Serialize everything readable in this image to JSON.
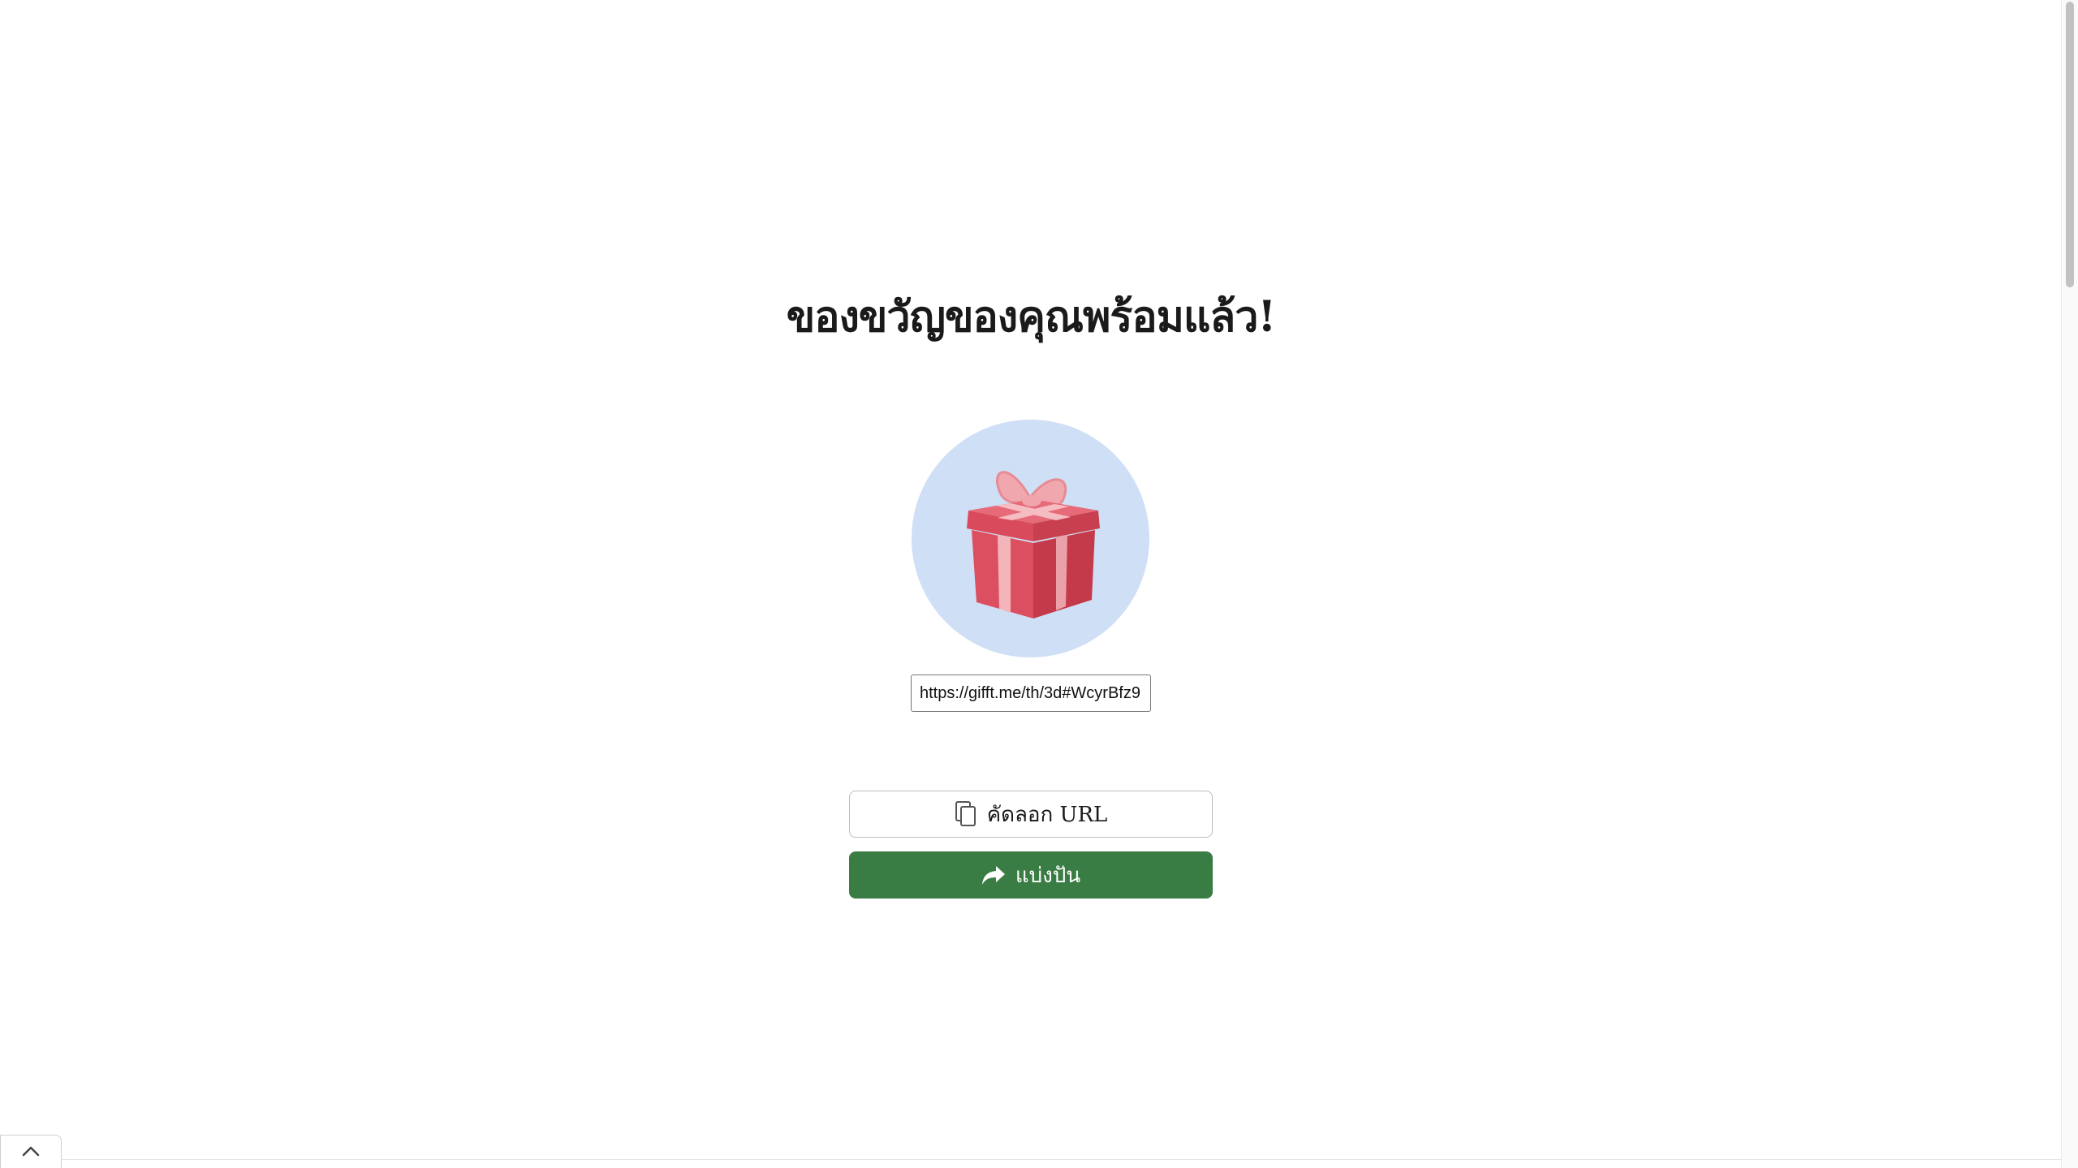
{
  "heading": {
    "title": "ของขวัญของคุณพร้อมแล้ว!"
  },
  "gift": {
    "icon": "gift-box-icon",
    "circle_color": "#cfdff5"
  },
  "url_field": {
    "value": "https://gifft.me/th/3d#WcyrBfz9"
  },
  "actions": {
    "copy_label": "คัดลอก URL",
    "copy_icon": "copy-icon",
    "share_label": "แบ่งปัน",
    "share_icon": "share-arrow-icon",
    "share_color": "#3a7d44"
  },
  "footer": {
    "toggle_icon": "chevron-up-icon"
  }
}
